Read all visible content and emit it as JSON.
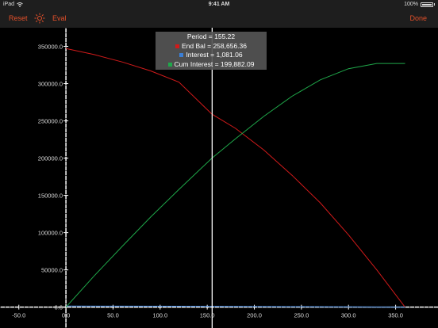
{
  "status_bar": {
    "carrier": "iPad",
    "time": "9:41 AM",
    "battery": "100%"
  },
  "nav": {
    "reset_label": "Reset",
    "eval_label": "Eval",
    "done_label": "Done",
    "settings_icon": "sun-icon"
  },
  "colors": {
    "accent": "#e4502a",
    "end_bal": "#d11a1a",
    "interest": "#3b7fd6",
    "cum_interest": "#1fa84a",
    "axis": "#ffffff",
    "cursor": "#ffffff"
  },
  "tooltip": {
    "period": "Period = 155.22",
    "end_bal": "End Bal = 258,656.36",
    "interest": "Interest = 1,081.06",
    "cum_interest": "Cum Interest = 199,882.09"
  },
  "chart_data": {
    "type": "line",
    "xlim": [
      -70,
      395
    ],
    "ylim": [
      -28000,
      375000
    ],
    "x_ticks": [
      -50,
      0,
      50,
      100,
      150,
      200,
      250,
      300,
      350
    ],
    "x_tick_labels": [
      "-50.0",
      "0.0",
      "50.0",
      "100.0",
      "150.0",
      "200.0",
      "250.0",
      "300.0",
      "350.0"
    ],
    "y_ticks": [
      0,
      50000,
      100000,
      150000,
      200000,
      250000,
      300000,
      350000
    ],
    "y_tick_labels": [
      "0.0",
      "50000.0",
      "100000.0",
      "150000.0",
      "200000.0",
      "250000.0",
      "300000.0",
      "350000.0"
    ],
    "cursor_x": 155.22,
    "series": [
      {
        "name": "End Bal",
        "x": [
          0,
          30,
          60,
          90,
          120,
          155,
          180,
          210,
          240,
          270,
          300,
          330,
          360
        ],
        "values": [
          347000,
          339000,
          329000,
          317000,
          302000,
          259000,
          240000,
          211000,
          177000,
          140000,
          97000,
          50000,
          0
        ]
      },
      {
        "name": "Interest",
        "x": [
          0,
          60,
          120,
          180,
          240,
          300,
          360
        ],
        "values": [
          1450,
          1370,
          1260,
          1000,
          740,
          400,
          0
        ]
      },
      {
        "name": "Cum Interest",
        "x": [
          0,
          30,
          60,
          90,
          120,
          155,
          180,
          210,
          240,
          270,
          300,
          330,
          360
        ],
        "values": [
          0,
          42000,
          82000,
          121000,
          158000,
          200000,
          226000,
          256000,
          283000,
          305000,
          320000,
          327000,
          327000
        ]
      }
    ]
  }
}
